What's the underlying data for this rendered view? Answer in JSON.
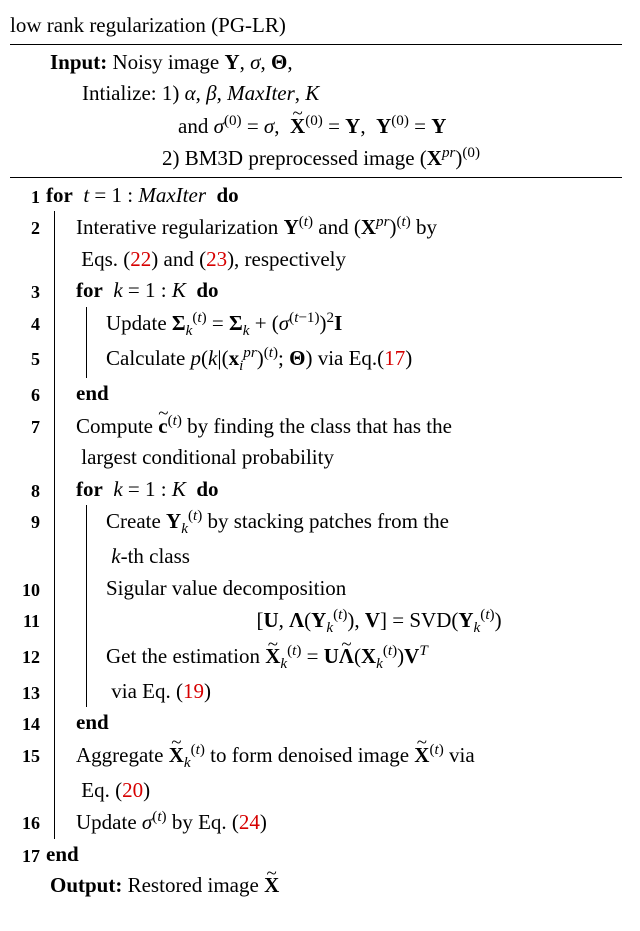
{
  "header": {
    "title_fragment": "low rank regularization (PG-LR)"
  },
  "input": {
    "label": "Input:",
    "line1": "Noisy image Y, σ, Θ,",
    "init_label": "Intialize:",
    "init1a": "1) α, β, MaxIter, K",
    "init1b": "and σ⁽⁰⁾ = σ,  X̃⁽⁰⁾ = Y,  Y⁽⁰⁾ = Y",
    "init2": "2) BM3D preprocessed image (Xᵖʳ)⁽⁰⁾"
  },
  "lines": {
    "l1": "for  t = 1 : MaxIter do",
    "l2a": "Interative regularization Y⁽ᵗ⁾ and (Xᵖʳ)⁽ᵗ⁾ by",
    "l2b": "Eqs. (22) and (23), respectively",
    "l3": "for  k = 1 : K do",
    "l4": "Update Σ_k⁽ᵗ⁾ = Σ_k + (σ⁽ᵗ⁻¹⁾)² I",
    "l5": "Calculate p(k | (xᵢᵖʳ)⁽ᵗ⁾; Θ) via Eq.(17)",
    "l6": "end",
    "l7a": "Compute c̃⁽ᵗ⁾ by finding the class that has the",
    "l7b": "largest conditional probability",
    "l8": "for  k = 1 : K do",
    "l9a": "Create Y_k⁽ᵗ⁾ by stacking patches from the",
    "l9b": "k-th class",
    "l10": "Sigular value decomposition",
    "l11": "[U, Λ(Y_k⁽ᵗ⁾), V] = SVD(Y_k⁽ᵗ⁾)",
    "l12": "Get the estimation X̃_k⁽ᵗ⁾ = U Λ̃(X_k⁽ᵗ⁾) Vᵀ",
    "l13": "via Eq. (19)",
    "l14": "end",
    "l15a": "Aggregate X̃_k⁽ᵗ⁾ to form denoised image X̃⁽ᵗ⁾ via",
    "l15b": "Eq. (20)",
    "l16": "Update σ⁽ᵗ⁾ by Eq. (24)",
    "l17": "end"
  },
  "output": {
    "label": "Output:",
    "text": "Restored image X̃"
  },
  "refs": {
    "r22": "22",
    "r23": "23",
    "r17": "17",
    "r19": "19",
    "r20": "20",
    "r24": "24"
  }
}
